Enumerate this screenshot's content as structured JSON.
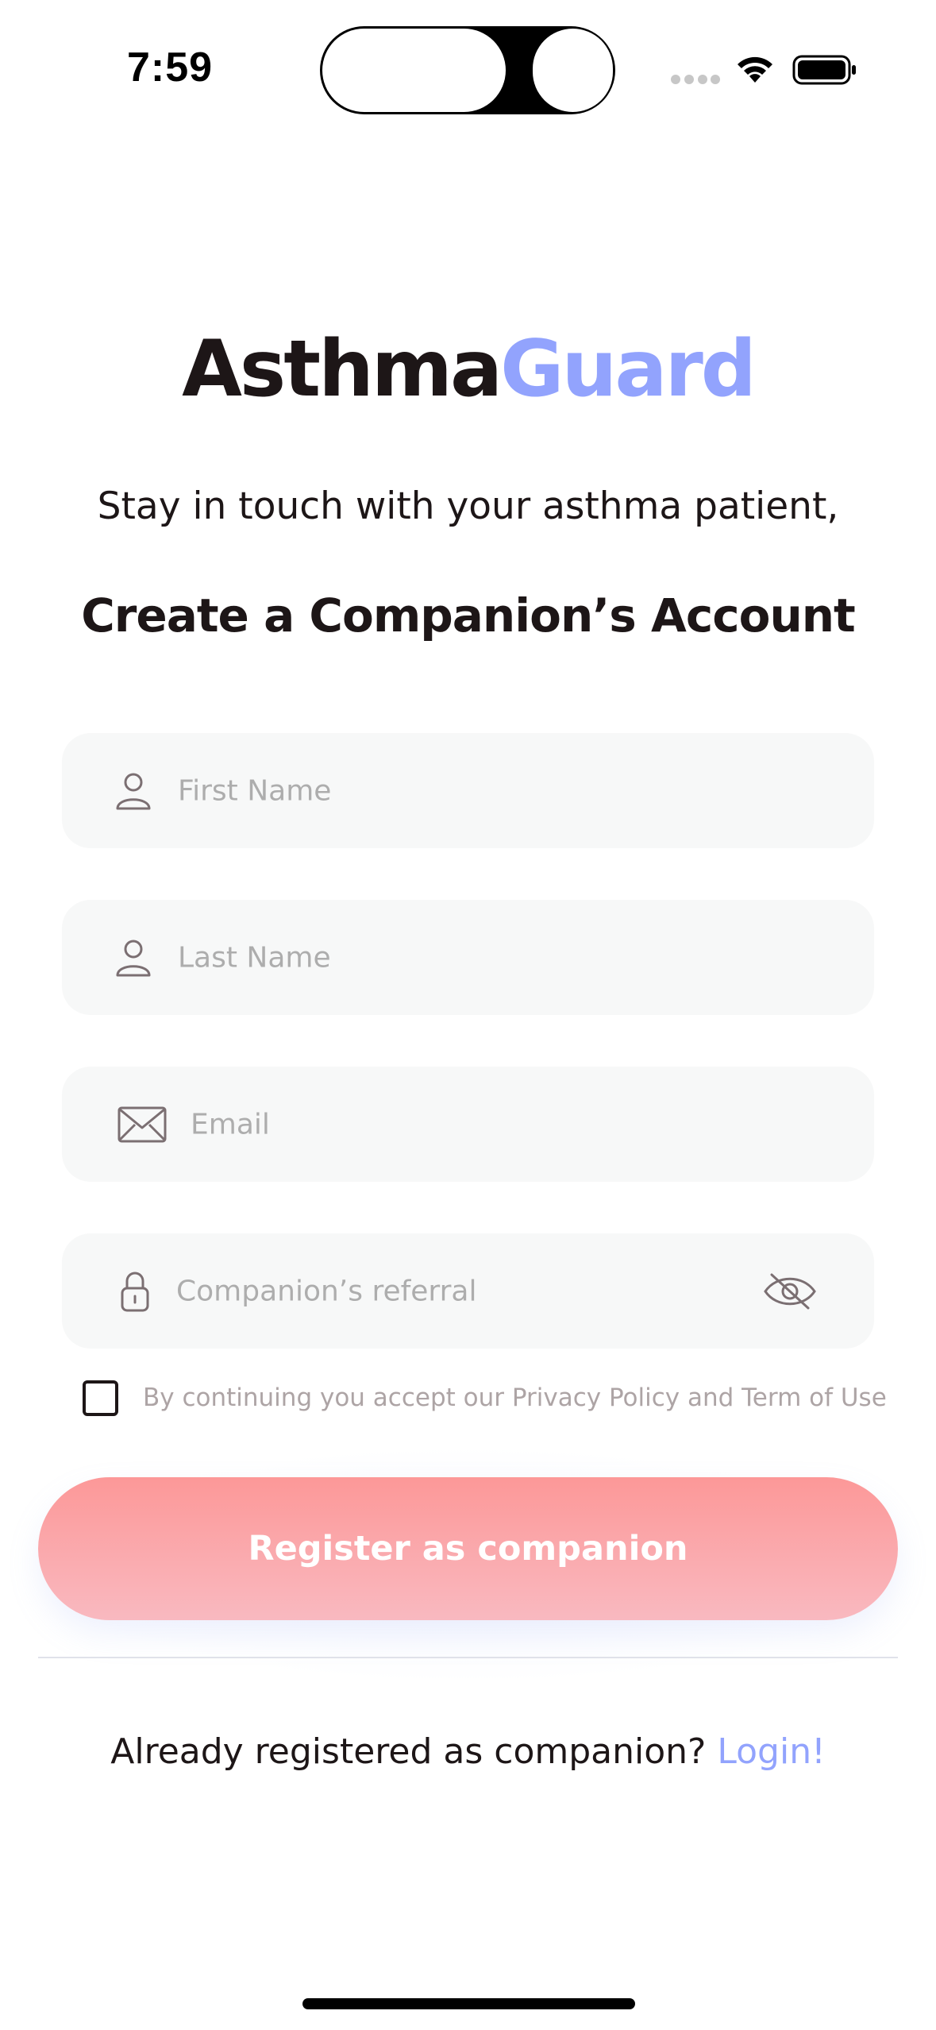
{
  "status_bar": {
    "time": "7:59"
  },
  "logo": {
    "part1": "Asthma",
    "part2": "Guard",
    "color_dark": "#1d1617",
    "color_accent": "#92a3fd"
  },
  "subtitle": "Stay in touch with your asthma patient,",
  "heading": "Create a Companion’s Account",
  "form": {
    "first_name": {
      "placeholder": "First Name",
      "icon": "person-icon"
    },
    "last_name": {
      "placeholder": "Last Name",
      "icon": "person-icon"
    },
    "email": {
      "placeholder": "Email",
      "icon": "mail-icon"
    },
    "referral": {
      "placeholder": "Companion’s referral",
      "icon": "lock-icon",
      "toggle_icon": "eye-off-icon"
    },
    "terms_checked": false,
    "terms_label": "By continuing you accept our Privacy Policy and Term of Use"
  },
  "register_button": {
    "label": "Register as companion",
    "gradient": [
      "#fc9898",
      "#f9b9c0"
    ]
  },
  "footer": {
    "prompt": "Already registered as companion? ",
    "link": "Login!"
  }
}
